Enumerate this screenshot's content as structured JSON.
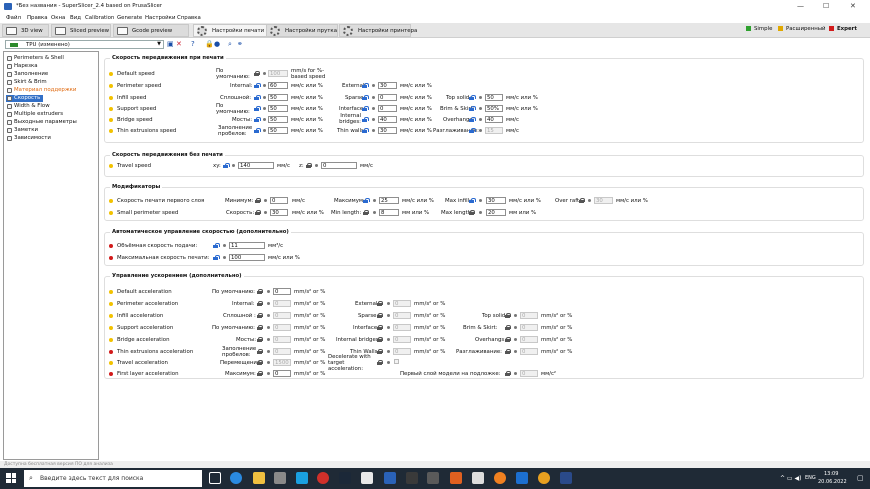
{
  "window": {
    "title": "*Без названия - SuperSlicer_2.4  based on PrusaSlicer",
    "minimize": "—",
    "maximize": "☐",
    "close": "✕"
  },
  "menu": [
    "Файл",
    "Правка",
    "Окна",
    "Вид",
    "Calibration",
    "Generate",
    "Настройки",
    "Справка"
  ],
  "tabs": [
    {
      "label": "3D view"
    },
    {
      "label": "Sliced preview"
    },
    {
      "label": "Gcode preview"
    },
    {
      "label": "Настройки печати",
      "active": true
    },
    {
      "label": "Настройки прутка"
    },
    {
      "label": "Настройки принтера"
    }
  ],
  "modes": [
    {
      "label": "Simple",
      "color": "#2ea12e"
    },
    {
      "label": "Расширенный",
      "color": "#e0a800"
    },
    {
      "label": "Expert",
      "color": "#d21a1a"
    }
  ],
  "preset": {
    "value": "TPU (изменено)"
  },
  "sidebar": {
    "items": [
      {
        "label": "Perimeters & Shell"
      },
      {
        "label": "Нарезка"
      },
      {
        "label": "Заполнение"
      },
      {
        "label": "Skirt & Brim"
      },
      {
        "label": "Материал поддержки",
        "orange": true
      },
      {
        "label": "Скорость",
        "selected": true
      },
      {
        "label": "Width & Flow"
      },
      {
        "label": "Multiple extruders"
      },
      {
        "label": "Выходные параметры"
      },
      {
        "label": "Заметки"
      },
      {
        "label": "Зависимости"
      }
    ]
  },
  "groups": {
    "print_speed": {
      "title": "Скорость передвижения при печати",
      "rows": {
        "default": {
          "name": "Default speed",
          "l1": "По умолчанию:",
          "v1": "100",
          "u1": "mm/s for %-based speed"
        },
        "perimeter": {
          "name": "Perimeter speed",
          "l1": "Internal:",
          "v1": "60",
          "u1": "мм/с или %",
          "l2": "External:",
          "v2": "30",
          "u2": "мм/с или %"
        },
        "infill": {
          "name": "Infill speed",
          "l1": "Сплошной:",
          "v1": "50",
          "u1": "мм/с или %",
          "l2": "Sparse:",
          "v2": "0",
          "u2": "мм/с или %",
          "l3": "Top solid:",
          "v3": "50",
          "u3": "мм/с или %"
        },
        "support": {
          "name": "Support speed",
          "l1": "По умолчанию:",
          "v1": "50",
          "u1": "мм/с или %",
          "l2": "Interface:",
          "v2": "0",
          "u2": "мм/с или %",
          "l3": "Brim & Skirt:",
          "v3": "50%",
          "u3": "мм/с или %"
        },
        "bridge": {
          "name": "Bridge speed",
          "l1": "Мосты:",
          "v1": "50",
          "u1": "мм/с или %",
          "l2": "Internal bridges:",
          "v2": "40",
          "u2": "мм/с или %",
          "l3": "Overhangs:",
          "v3": "40",
          "u3": "мм/с"
        },
        "thin": {
          "name": "Thin extrusions speed",
          "l1": "Заполнение пробелов:",
          "v1": "50",
          "u1": "мм/с или %",
          "l2": "Thin walls:",
          "v2": "30",
          "u2": "мм/с или %",
          "l3": "Разглаживание:",
          "v3": "15",
          "u3": "мм/с"
        }
      }
    },
    "travel_speed": {
      "title": "Скорость передвижения без печати",
      "row": {
        "name": "Travel speed",
        "l1": "xy:",
        "v1": "140",
        "u1": "мм/с",
        "l2": "z:",
        "v2": "0",
        "u2": "мм/с"
      }
    },
    "modifiers": {
      "title": "Модификаторы",
      "rows": {
        "first_layer": {
          "name": "Скорость печати первого слоя",
          "l1": "Минимум:",
          "v1": "0",
          "u1": "мм/с",
          "l2": "Максимум:",
          "v2": "25",
          "u2": "мм/с или %",
          "l3": "Max infill:",
          "v3": "30",
          "u3": "мм/с или %",
          "l4": "Over raft:",
          "v4": "30",
          "u4": "мм/с или %"
        },
        "small_perimeter": {
          "name": "Small perimeter speed",
          "l1": "Скорость:",
          "v1": "30",
          "u1": "мм/с или %",
          "l2": "Min length:",
          "v2": "8",
          "u2": "мм или %",
          "l3": "Max length:",
          "v3": "20",
          "u3": "мм или %"
        }
      }
    },
    "auto_speed": {
      "title": "Автоматическое управление скоростью (дополнительно)",
      "rows": {
        "volumetric": {
          "name": "Объёмная скорость подачи:",
          "v1": "11",
          "u1": "мм³/с"
        },
        "max_speed": {
          "name": "Максимальная скорость печати:",
          "v1": "100",
          "u1": "мм/с или %"
        }
      }
    },
    "accel": {
      "title": "Управление ускорением (дополнительно)",
      "rows": {
        "default": {
          "name": "Default acceleration",
          "l1": "По умолчанию:",
          "v1": "0",
          "u1": "mm/s² or %"
        },
        "perimeter": {
          "name": "Perimeter acceleration",
          "l1": "Internal:",
          "v1": "0",
          "u1": "mm/s² or %",
          "l2": "External:",
          "v2": "0",
          "u2": "mm/s² or %"
        },
        "infill": {
          "name": "Infill acceleration",
          "l1": "Сплошной :",
          "v1": "0",
          "u1": "mm/s² or %",
          "l2": "Sparse:",
          "v2": "0",
          "u2": "mm/s² or %",
          "l3": "Top solid :",
          "v3": "0",
          "u3": "mm/s² or %"
        },
        "support": {
          "name": "Support acceleration",
          "l1": "По умолчанию:",
          "v1": "0",
          "u1": "mm/s² or %",
          "l2": "Interface:",
          "v2": "0",
          "u2": "mm/s² or %",
          "l3": "Brim & Skirt:",
          "v3": "0",
          "u3": "mm/s² or %"
        },
        "bridge": {
          "name": "Bridge acceleration",
          "l1": "Мосты:",
          "v1": "0",
          "u1": "mm/s² or %",
          "l2": "Internal bridges :",
          "v2": "0",
          "u2": "mm/s² or %",
          "l3": "Overhangs:",
          "v3": "0",
          "u3": "mm/s² or %"
        },
        "thin": {
          "name": "Thin extrusions acceleration",
          "l1": "Заполнение пробелов:",
          "v1": "0",
          "u1": "mm/s² or %",
          "l2": "Thin Walls:",
          "v2": "0",
          "u2": "mm/s² or %",
          "l3": "Разглаживание:",
          "v3": "0",
          "u3": "mm/s² or %"
        },
        "travel": {
          "name": "Travel acceleration",
          "l1": "Перемещение:",
          "v1": "1500",
          "u1": "mm/s² or %",
          "l2": "Decelerate with target acceleration:"
        },
        "first_layer": {
          "name": "First layer acceleration",
          "l1": "Максимум:",
          "v1": "0",
          "u1": "mm/s² or %",
          "l3": "Первый слой модели на подложке:",
          "v3": "0",
          "u3": "мм/с²"
        }
      }
    }
  },
  "statusbar": {
    "text": "Доступна бесплатная версия ПО для анализа"
  },
  "taskbar": {
    "search_placeholder": "Введите здесь текст для поиска",
    "lang": "ENG",
    "time": "13:09",
    "date": "20.06.2022"
  }
}
